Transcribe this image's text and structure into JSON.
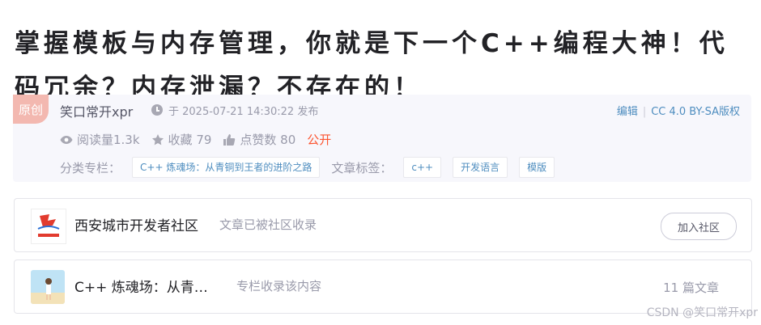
{
  "article": {
    "title": "掌握模板与内存管理，你就是下一个C++编程大神！代码冗余？内存泄漏？不存在的！"
  },
  "meta": {
    "badge": "原创",
    "author": "笑口常开xpr",
    "time": "于 2025-07-21 14:30:22 发布",
    "edit": "编辑",
    "license": "CC 4.0 BY-SA版权",
    "reads": "阅读量1.3k",
    "favorites": "收藏 79",
    "likes": "点赞数 80",
    "visibility": "公开",
    "category_label": "分类专栏：",
    "category": "C++ 炼魂场：从青铜到王者的进阶之路",
    "tags_label": "文章标签：",
    "tags": [
      "c++",
      "开发语言",
      "模版"
    ]
  },
  "community": {
    "name": "西安城市开发者社区",
    "desc": "文章已被社区收录",
    "join": "加入社区"
  },
  "column": {
    "name": "C++ 炼魂场：从青…",
    "desc": "专栏收录该内容",
    "count": "11 篇文章"
  },
  "watermark": "CSDN @笑口常开xpr",
  "colors": {
    "accent": "#fc5531",
    "link": "#4e8dbf",
    "badge": "#f3b8b0"
  }
}
